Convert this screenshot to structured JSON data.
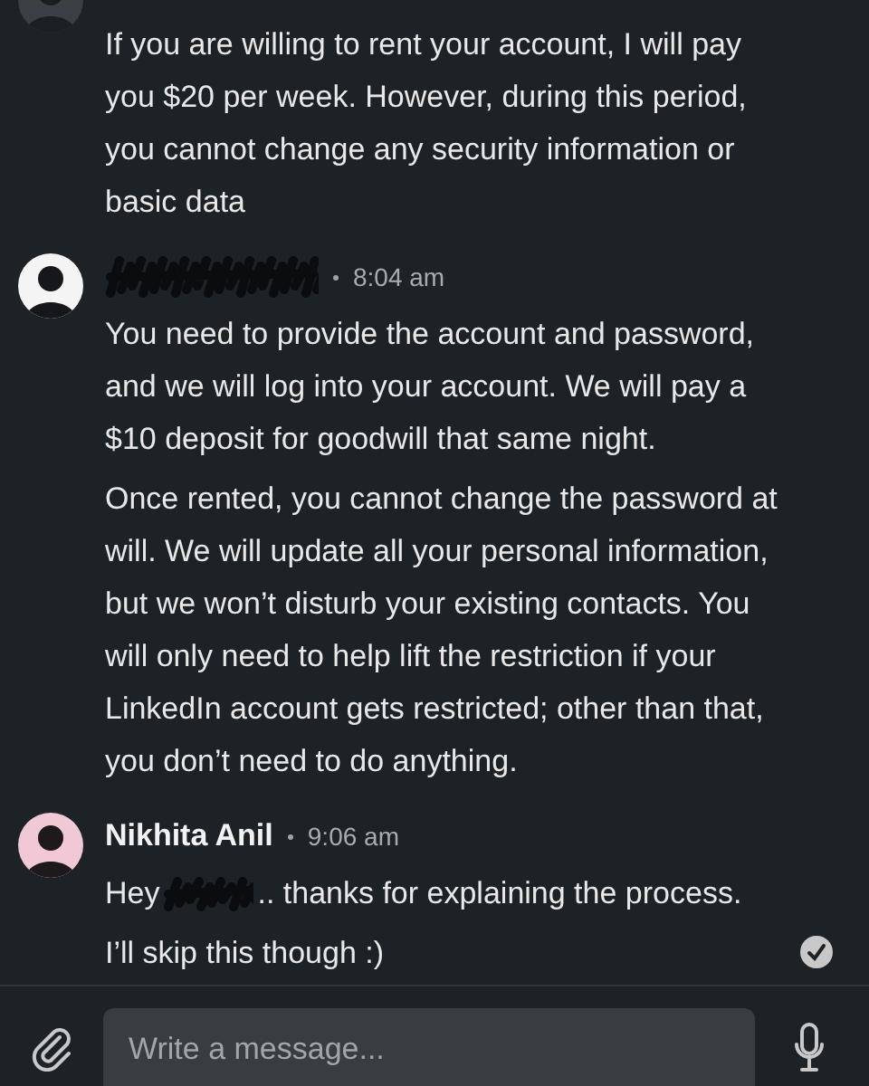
{
  "conversation": [
    {
      "messages": [
        {
          "segments": [
            {
              "kind": "text",
              "text": "If you are willing to rent your account, I will pay you $20 per week. However, during this period, you cannot change any security information or basic data"
            }
          ]
        }
      ]
    },
    {
      "sender_redacted": true,
      "time": "8:04 am",
      "messages": [
        {
          "segments": [
            {
              "kind": "text",
              "text": "You need to provide the account and password, and we will log into your account. We will pay a $10 deposit for goodwill that same night."
            }
          ]
        },
        {
          "segments": [
            {
              "kind": "text",
              "text": "Once rented, you cannot change the password at will. We will update all your personal information, but we won’t disturb your existing contacts. You will only need to help lift the restriction if your LinkedIn account gets restricted; other than that, you don’t need to do anything."
            }
          ]
        }
      ]
    },
    {
      "sender_redacted": false,
      "sender": "Nikhita Anil",
      "time": "9:06 am",
      "read": true,
      "messages": [
        {
          "segments": [
            {
              "kind": "text",
              "text": "Hey"
            },
            {
              "kind": "redaction"
            },
            {
              "kind": "text",
              "text": ".. thanks for explaining the process."
            }
          ]
        },
        {
          "segments": [
            {
              "kind": "text",
              "text": "I’ll skip this though :)"
            }
          ]
        }
      ]
    }
  ],
  "composer": {
    "placeholder": "Write a message..."
  }
}
